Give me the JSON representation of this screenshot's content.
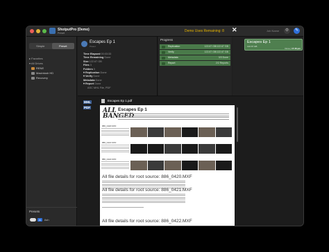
{
  "titlebar": {
    "app_title": "ShotputPro (Demo)",
    "app_subtitle": "Preset",
    "demo_notice": "Demo Uses Remaining: 8",
    "close_glyph": "✕",
    "job_name_placeholder": "Job Name",
    "gear_icon": "⚙",
    "edit_icon": "✎"
  },
  "sidebar": {
    "tabs": [
      "Simple",
      "Preset"
    ],
    "favorites_label": "▸ Favorites",
    "all_drives_label": "▾ All Drives",
    "drives": [
      "RENE",
      "Macintosh HD",
      "Recovery"
    ],
    "presets_label": "Presets",
    "preset_badge": "A",
    "preset_name": "Ash"
  },
  "job": {
    "title": "Escapes Ep 1",
    "subtitle": "Preset",
    "details": [
      {
        "k": "Time Elapsed",
        "v": "00:03:33"
      },
      {
        "k": "Time Remaining",
        "v": "Done"
      },
      {
        "k": "Size",
        "v": "122.67 GB"
      },
      {
        "k": "Files",
        "v": "3"
      },
      {
        "k": "Folders",
        "v": "0"
      },
      {
        "k": "▾ Replication",
        "v": "Done"
      },
      {
        "k": "▾ Verify",
        "v": "Done"
      },
      {
        "k": "Metadata",
        "v": "Done"
      },
      {
        "k": "▾ Report",
        "v": "Done"
      },
      {
        "k": "",
        "v": "ASC MHL File, PDF"
      }
    ]
  },
  "progress": {
    "header": "Progress",
    "rows": [
      {
        "label": "Replication",
        "value": "122.67 GB/122.67 GB"
      },
      {
        "label": "Verify",
        "value": "122.67 GB/122.67 GB"
      },
      {
        "label": "Metadata",
        "value": "3/3 Done"
      },
      {
        "label": "Report",
        "value": "2/2 Reports"
      }
    ]
  },
  "job_card": {
    "title": "Escapes Ep 1",
    "size": "122.67 GB",
    "status_prefix": "Done |",
    "time": "17:46 pm"
  },
  "report": {
    "formats": [
      "MHL",
      "PDF"
    ],
    "file_name": "Escapes Ep 1.pdf",
    "doc": {
      "logo": "ALL\nBANGED",
      "title": "Escapes Ep 1",
      "root_headings": [
        "All file details for root source: 886_0420.MXF",
        "All file details for root source: 886_0421.MXF",
        "All file details for root source: 886_0422.MXF"
      ],
      "file_labels": [
        "886_0420.MXF",
        "886_0421.MXF",
        "886_0422.MXF"
      ]
    }
  }
}
